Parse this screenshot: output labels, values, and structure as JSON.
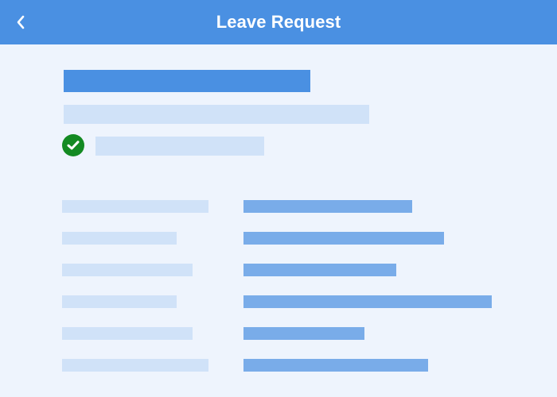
{
  "header": {
    "title": "Leave Request",
    "back_icon": "chevron-left-icon",
    "background": "#4a90e2",
    "text_color": "#ffffff"
  },
  "summary": {
    "status_icon": "check-circle-icon",
    "status_color": "#138a22"
  },
  "details": {
    "row_count": 6
  }
}
